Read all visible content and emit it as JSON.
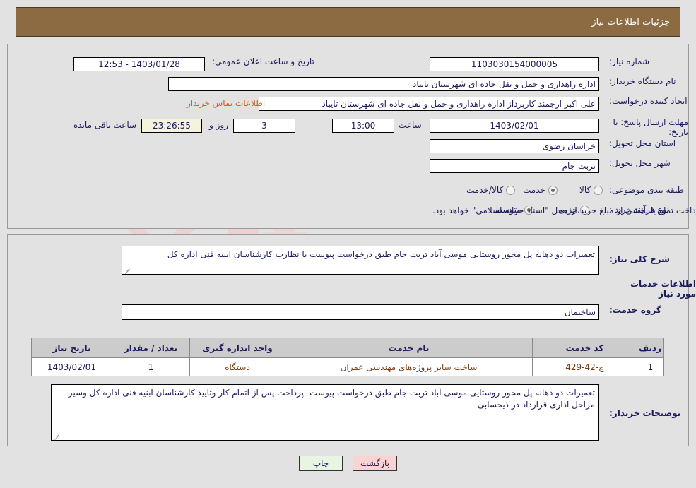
{
  "header": {
    "title": "جزئیات اطلاعات نیاز"
  },
  "watermark": {
    "text": "AriaTender.net"
  },
  "need_info": {
    "need_number": {
      "label": "شماره نیاز:",
      "value": "1103030154000005"
    },
    "public_announce": {
      "label": "تاریخ و ساعت اعلان عمومی:",
      "value": "1403/01/28 - 12:53"
    },
    "buyer_org": {
      "label": "نام دستگاه خریدار:",
      "value": "اداره راهداری و حمل و نقل جاده ای شهرستان تایباد"
    },
    "request_creator": {
      "label": "ایجاد کننده درخواست:",
      "value": "علی اکبر ارجمند کاربرداز اداره راهداری و حمل و نقل جاده ای شهرستان تایباد"
    },
    "contact_link": "اطلاعات تماس خریدار",
    "deadline": {
      "label": "مهلت ارسال پاسخ: تا تاریخ:",
      "date": "1403/02/01",
      "hour_label": "ساعت",
      "hour": "13:00",
      "days": "3",
      "days_suffix_label": "روز و",
      "countdown": "23:26:55",
      "countdown_suffix_label": "ساعت باقی مانده"
    },
    "province": {
      "label": "استان محل تحویل:",
      "value": "خراسان رضوی"
    },
    "city": {
      "label": "شهر محل تحویل:",
      "value": "تربت جام"
    },
    "category": {
      "label": "طبقه بندی موضوعی:",
      "options": [
        "کالا",
        "خدمت",
        "کالا/خدمت"
      ],
      "selected": "خدمت"
    },
    "purchase_type": {
      "label": "نوع فرآیند خرید :",
      "options": [
        "جزیی",
        "متوسط"
      ],
      "selected": "متوسط",
      "note": "پرداخت تمام یا بخشی از مبلغ خرید،از محل \"اسناد خزانه اسلامی\" خواهد بود.",
      "note_checked": false
    }
  },
  "need_detail": {
    "summary": {
      "label": "شرح کلی نیاز:",
      "value": "تعمیرات دو دهانه پل محور روستایی موسی آباد تربت جام طبق درخواست پیوست با نظارت کارشناسان ابنیه فنی اداره کل"
    },
    "services_section_title": "اطلاعات خدمات مورد نیاز",
    "service_group": {
      "label": "گروه خدمت:",
      "value": "ساختمان"
    },
    "table": {
      "columns": [
        "ردیف",
        "کد خدمت",
        "نام خدمت",
        "واحد اندازه گیری",
        "تعداد / مقدار",
        "تاریخ نیاز"
      ],
      "rows": [
        {
          "row_no": "1",
          "service_code": "ج-42-429",
          "service_name": "ساخت سایر پروژه‌های مهندسی عمران",
          "unit": "دستگاه",
          "quantity": "1",
          "need_date": "1403/02/01"
        }
      ]
    },
    "buyer_notes": {
      "label": "توضیحات خریدار:",
      "value": "تعمیرات دو دهانه پل محور روستایی موسی آباد تربت جام طبق درخواست پیوست -پرداخت پس از اتمام کار وتایید کارشناسان ابنیه فنی اداره کل وسیر مراحل اداری قرارداد در ذیحسابی"
    }
  },
  "footer": {
    "print_button": "چاپ",
    "back_button": "بازگشت"
  },
  "colors": {
    "header_bg": "#8d6b42",
    "page_bg": "#e2e2e2",
    "label_text": "#1b1b5a",
    "link": "#d4581a",
    "table_header_bg": "#cccccc",
    "table_cell_text": "#7a3b13",
    "countdown_bg": "#f5f3dc",
    "back_button_bg": "#fbd3d3",
    "print_button_bg": "#e7f5e2"
  }
}
